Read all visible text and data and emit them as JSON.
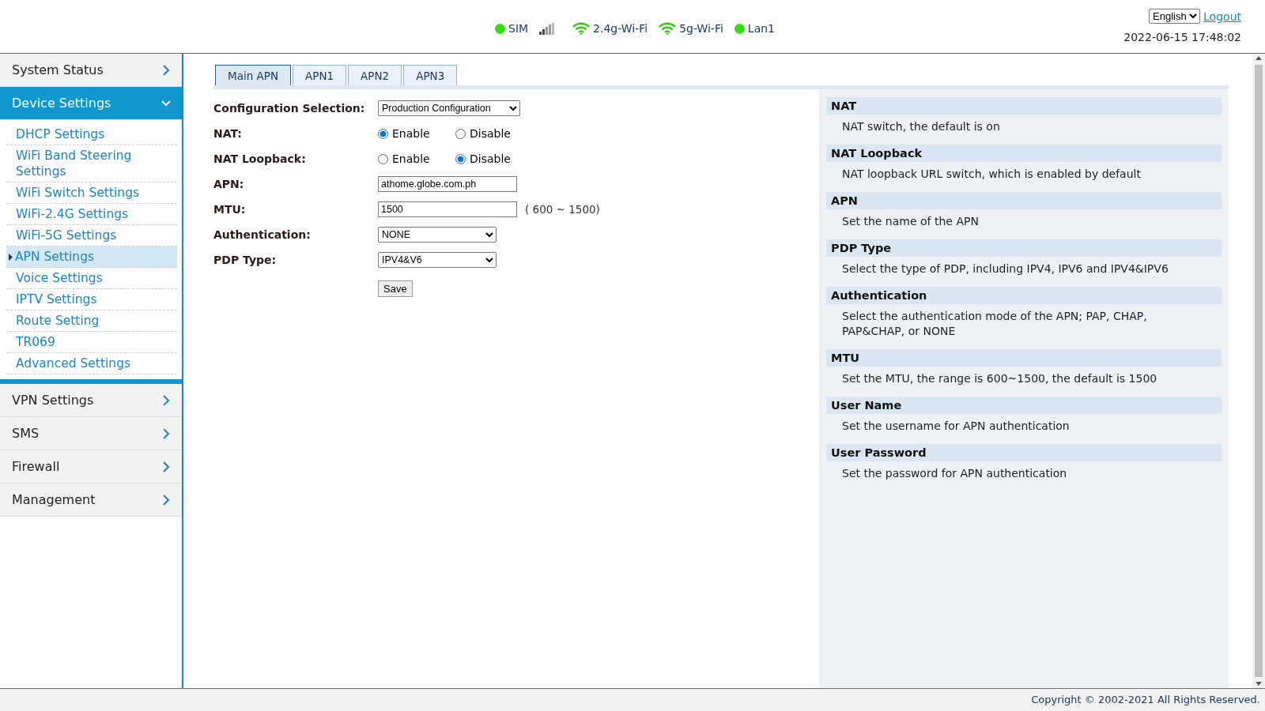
{
  "header": {
    "status": [
      {
        "kind": "dot",
        "label": "SIM",
        "color": "#33dd11"
      },
      {
        "kind": "signal"
      },
      {
        "kind": "wifi",
        "label": "2.4g-Wi-Fi"
      },
      {
        "kind": "wifi",
        "label": "5g-Wi-Fi"
      },
      {
        "kind": "dot",
        "label": "Lan1",
        "color": "#33dd11"
      }
    ],
    "language": "English",
    "logout": "Logout",
    "datetime": "2022-06-15 17:48:02"
  },
  "sidebar": {
    "sections": [
      {
        "label": "System Status",
        "expanded": false
      },
      {
        "label": "Device Settings",
        "expanded": true,
        "children": [
          {
            "label": "DHCP Settings",
            "selected": false
          },
          {
            "label": "WiFi Band Steering Settings",
            "selected": false
          },
          {
            "label": "WiFi Switch Settings",
            "selected": false
          },
          {
            "label": "WiFi-2.4G Settings",
            "selected": false
          },
          {
            "label": "WiFi-5G Settings",
            "selected": false
          },
          {
            "label": "APN Settings",
            "selected": true
          },
          {
            "label": "Voice Settings",
            "selected": false
          },
          {
            "label": "IPTV Settings",
            "selected": false
          },
          {
            "label": "Route Setting",
            "selected": false
          },
          {
            "label": "TR069",
            "selected": false
          },
          {
            "label": "Advanced Settings",
            "selected": false
          }
        ]
      },
      {
        "label": "VPN Settings",
        "expanded": false
      },
      {
        "label": "SMS",
        "expanded": false
      },
      {
        "label": "Firewall",
        "expanded": false
      },
      {
        "label": "Management",
        "expanded": false
      }
    ]
  },
  "tabs": [
    {
      "label": "Main APN",
      "selected": true
    },
    {
      "label": "APN1",
      "selected": false
    },
    {
      "label": "APN2",
      "selected": false
    },
    {
      "label": "APN3",
      "selected": false
    }
  ],
  "form": {
    "rows": [
      {
        "kind": "select",
        "label": "Configuration Selection:",
        "value": "Production Configuration",
        "wide": true
      },
      {
        "kind": "radio",
        "label": "NAT:",
        "options": [
          {
            "label": "Enable",
            "selected": true
          },
          {
            "label": "Disable",
            "selected": false
          }
        ]
      },
      {
        "kind": "radio",
        "label": "NAT Loopback:",
        "options": [
          {
            "label": "Enable",
            "selected": false
          },
          {
            "label": "Disable",
            "selected": true
          }
        ]
      },
      {
        "kind": "text",
        "label": "APN:",
        "value": "athome.globe.com.ph"
      },
      {
        "kind": "text",
        "label": "MTU:",
        "value": "1500",
        "hint": "( 600 ~ 1500)"
      },
      {
        "kind": "select",
        "label": "Authentication:",
        "value": "NONE"
      },
      {
        "kind": "select",
        "label": "PDP Type:",
        "value": "IPV4&V6"
      }
    ],
    "save": "Save"
  },
  "help": [
    {
      "title": "NAT",
      "text": "NAT switch, the default is on"
    },
    {
      "title": "NAT Loopback",
      "text": "NAT loopback URL switch, which is enabled by default"
    },
    {
      "title": "APN",
      "text": "Set the name of the APN"
    },
    {
      "title": "PDP Type",
      "text": "Select the type of PDP, including IPV4, IPV6 and IPV4&IPV6"
    },
    {
      "title": "Authentication",
      "text": "Select the authentication mode of the APN; PAP, CHAP, PAP&CHAP, or NONE"
    },
    {
      "title": "MTU",
      "text": "Set the MTU, the range is 600~1500, the default is 1500"
    },
    {
      "title": "User Name",
      "text": "Set the username for APN authentication"
    },
    {
      "title": "User Password",
      "text": "Set the password for APN authentication"
    }
  ],
  "footer": "Copyright © 2002-2021 All Rights Reserved."
}
